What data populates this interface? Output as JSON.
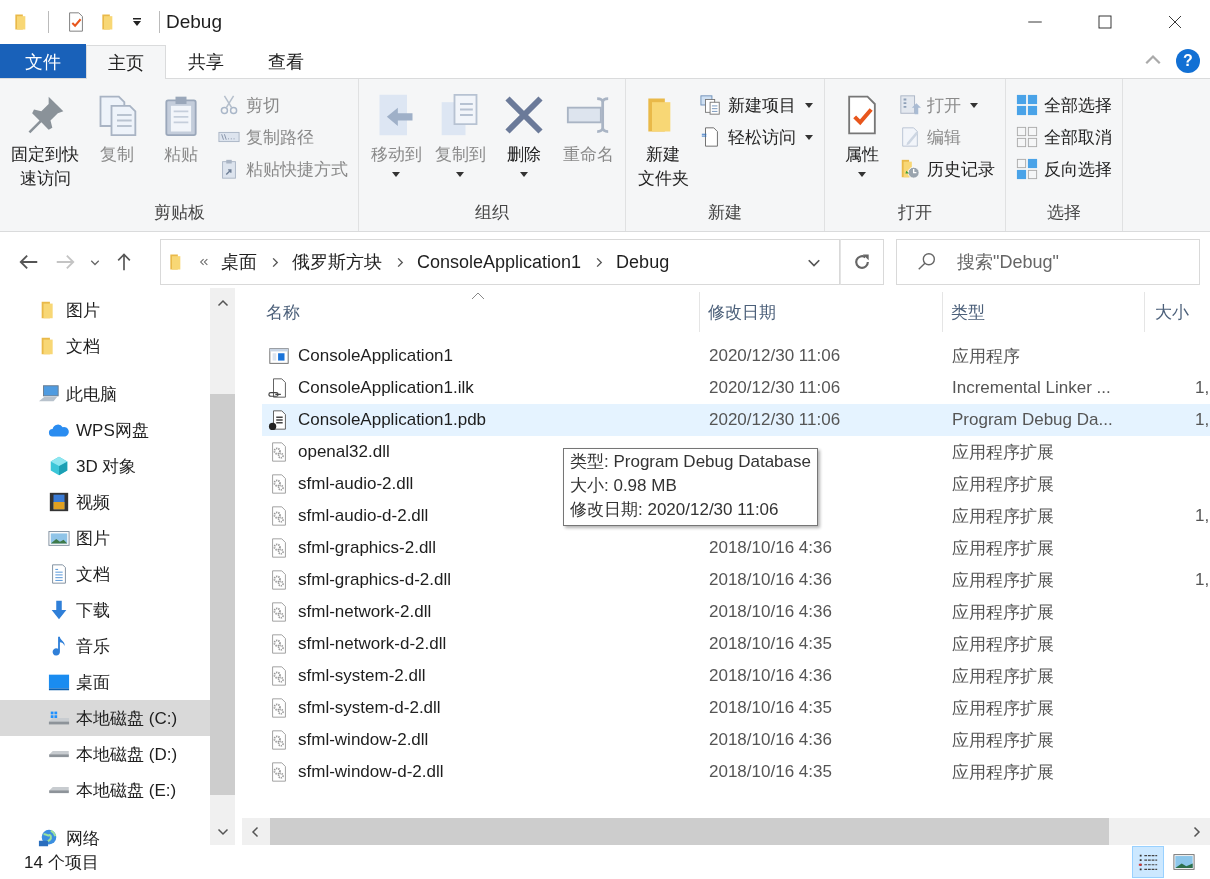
{
  "window": {
    "title": "Debug"
  },
  "ribbon_tabs": [
    {
      "label": "文件",
      "kind": "file",
      "selected": false
    },
    {
      "label": "主页",
      "kind": "tab",
      "selected": true
    },
    {
      "label": "共享",
      "kind": "tab",
      "selected": false
    },
    {
      "label": "查看",
      "kind": "tab",
      "selected": false
    }
  ],
  "help": "?",
  "ribbon_groups": [
    {
      "label": "剪贴板",
      "buttons": [
        {
          "kind": "large",
          "lines": [
            "固定到快",
            "速访问"
          ],
          "disabled": false,
          "dropdown": false
        },
        {
          "kind": "large",
          "lines": [
            "复制"
          ],
          "disabled": true,
          "dropdown": false
        },
        {
          "kind": "large",
          "lines": [
            "粘贴"
          ],
          "disabled": true,
          "dropdown": false
        },
        {
          "kind": "small",
          "lines": [
            "剪切"
          ],
          "disabled": true,
          "dropdown": false
        },
        {
          "kind": "small",
          "lines": [
            "复制路径"
          ],
          "disabled": true,
          "dropdown": false
        },
        {
          "kind": "small",
          "lines": [
            "粘贴快捷方式"
          ],
          "disabled": true,
          "dropdown": false
        }
      ]
    },
    {
      "label": "组织",
      "buttons": [
        {
          "kind": "large",
          "lines": [
            "移动到"
          ],
          "disabled": true,
          "dropdown": true
        },
        {
          "kind": "large",
          "lines": [
            "复制到"
          ],
          "disabled": true,
          "dropdown": true
        },
        {
          "kind": "large",
          "lines": [
            "删除"
          ],
          "disabled": false,
          "dropdown": true
        },
        {
          "kind": "large",
          "lines": [
            "重命名"
          ],
          "disabled": true,
          "dropdown": false
        }
      ]
    },
    {
      "label": "新建",
      "buttons": [
        {
          "kind": "large",
          "lines": [
            "新建",
            "文件夹"
          ],
          "disabled": false,
          "dropdown": false
        },
        {
          "kind": "small",
          "lines": [
            "新建项目"
          ],
          "disabled": false,
          "dropdown": true
        },
        {
          "kind": "small",
          "lines": [
            "轻松访问"
          ],
          "disabled": false,
          "dropdown": true
        }
      ]
    },
    {
      "label": "打开",
      "buttons": [
        {
          "kind": "large",
          "lines": [
            "属性"
          ],
          "disabled": false,
          "dropdown": true
        },
        {
          "kind": "small",
          "lines": [
            "打开"
          ],
          "disabled": true,
          "dropdown": true
        },
        {
          "kind": "small",
          "lines": [
            "编辑"
          ],
          "disabled": true,
          "dropdown": false
        },
        {
          "kind": "small",
          "lines": [
            "历史记录"
          ],
          "disabled": false,
          "dropdown": false
        }
      ]
    },
    {
      "label": "选择",
      "buttons": [
        {
          "kind": "small",
          "lines": [
            "全部选择"
          ],
          "disabled": false,
          "dropdown": false
        },
        {
          "kind": "small",
          "lines": [
            "全部取消"
          ],
          "disabled": false,
          "dropdown": false
        },
        {
          "kind": "small",
          "lines": [
            "反向选择"
          ],
          "disabled": false,
          "dropdown": false
        }
      ]
    }
  ],
  "navigation": {
    "back_disabled": false,
    "forward_disabled": true
  },
  "address": {
    "crumbs": [
      "桌面",
      "俄罗斯方块",
      "ConsoleApplication1",
      "Debug"
    ]
  },
  "search": {
    "placeholder": "搜索\"Debug\""
  },
  "nav_pane": [
    {
      "label": "图片",
      "kind": "folder",
      "selected": false
    },
    {
      "label": "文档",
      "kind": "folder",
      "selected": false
    },
    {
      "label": "此电脑",
      "kind": "computer",
      "selected": false,
      "children": [
        {
          "label": "WPS网盘",
          "kind": "cloud",
          "selected": false
        },
        {
          "label": "3D 对象",
          "kind": "cube",
          "selected": false
        },
        {
          "label": "视频",
          "kind": "video",
          "selected": false
        },
        {
          "label": "图片",
          "kind": "pictures",
          "selected": false
        },
        {
          "label": "文档",
          "kind": "documents",
          "selected": false
        },
        {
          "label": "下载",
          "kind": "downloads",
          "selected": false
        },
        {
          "label": "音乐",
          "kind": "music",
          "selected": false
        },
        {
          "label": "桌面",
          "kind": "desktop",
          "selected": false
        },
        {
          "label": "本地磁盘 (C:)",
          "kind": "systemdrive",
          "selected": true
        },
        {
          "label": "本地磁盘 (D:)",
          "kind": "drive",
          "selected": false
        },
        {
          "label": "本地磁盘 (E:)",
          "kind": "drive",
          "selected": false
        }
      ]
    },
    {
      "label": "网络",
      "kind": "network",
      "selected": false
    }
  ],
  "file_list": {
    "columns": [
      {
        "label": "名称",
        "sorted": true
      },
      {
        "label": "修改日期",
        "sorted": false
      },
      {
        "label": "类型",
        "sorted": false
      },
      {
        "label": "大小",
        "sorted": false
      }
    ],
    "rows": [
      {
        "name": "ConsoleApplication1",
        "kind": "exe",
        "date": "2020/12/30 11:06",
        "type": "应用程序",
        "selected": false
      },
      {
        "name": "ConsoleApplication1.ilk",
        "kind": "ilk",
        "date": "2020/12/30 11:06",
        "type": "Incremental Linker ...",
        "size": "1,",
        "selected": false
      },
      {
        "name": "ConsoleApplication1.pdb",
        "kind": "pdb",
        "date": "2020/12/30 11:06",
        "type": "Program Debug Da...",
        "size": "1,",
        "selected": true
      },
      {
        "name": "openal32.dll",
        "kind": "dll",
        "type": "应用程序扩展",
        "selected": false
      },
      {
        "name": "sfml-audio-2.dll",
        "kind": "dll",
        "type": "应用程序扩展",
        "selected": false
      },
      {
        "name": "sfml-audio-d-2.dll",
        "kind": "dll",
        "type": "应用程序扩展",
        "size": "1,",
        "selected": false
      },
      {
        "name": "sfml-graphics-2.dll",
        "kind": "dll",
        "date": "2018/10/16 4:36",
        "type": "应用程序扩展",
        "selected": false
      },
      {
        "name": "sfml-graphics-d-2.dll",
        "kind": "dll",
        "date": "2018/10/16 4:36",
        "type": "应用程序扩展",
        "size": "1,",
        "selected": false
      },
      {
        "name": "sfml-network-2.dll",
        "kind": "dll",
        "date": "2018/10/16 4:36",
        "type": "应用程序扩展",
        "selected": false
      },
      {
        "name": "sfml-network-d-2.dll",
        "kind": "dll",
        "date": "2018/10/16 4:35",
        "type": "应用程序扩展",
        "selected": false
      },
      {
        "name": "sfml-system-2.dll",
        "kind": "dll",
        "date": "2018/10/16 4:36",
        "type": "应用程序扩展",
        "selected": false
      },
      {
        "name": "sfml-system-d-2.dll",
        "kind": "dll",
        "date": "2018/10/16 4:35",
        "type": "应用程序扩展",
        "selected": false
      },
      {
        "name": "sfml-window-2.dll",
        "kind": "dll",
        "date": "2018/10/16 4:36",
        "type": "应用程序扩展",
        "selected": false
      },
      {
        "name": "sfml-window-d-2.dll",
        "kind": "dll",
        "date": "2018/10/16 4:35",
        "type": "应用程序扩展",
        "selected": false
      }
    ]
  },
  "tooltip": {
    "lines": [
      "类型: Program Debug Database",
      "大小: 0.98 MB",
      "修改日期: 2020/12/30 11:06"
    ]
  },
  "status_bar": {
    "item_count": "14 个项目",
    "views": [
      {
        "kind": "details",
        "selected": true
      },
      {
        "kind": "large_icons",
        "selected": false
      }
    ]
  }
}
